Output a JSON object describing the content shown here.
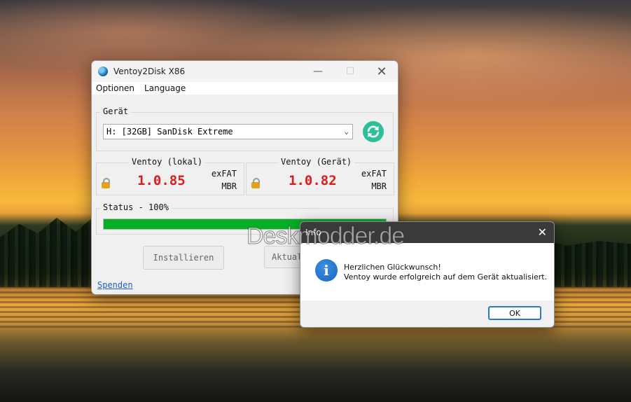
{
  "watermark": "Deskmodder.de",
  "window": {
    "title": "Ventoy2Disk  X86",
    "menu": [
      "Optionen",
      "Language"
    ],
    "device_group_label": "Gerät",
    "device_selected": "H: [32GB] SanDisk Extreme",
    "local": {
      "label": "Ventoy (lokal)",
      "version": "1.0.85",
      "fs": "exFAT",
      "partition": "MBR"
    },
    "device": {
      "label": "Ventoy (Gerät)",
      "version": "1.0.82",
      "fs": "exFAT",
      "partition": "MBR"
    },
    "status_label": "Status - 100%",
    "progress_percent": 100,
    "install_button": "Installieren",
    "update_button": "Aktual",
    "donate_link": "Spenden"
  },
  "dialog": {
    "title": "Info",
    "line1": "Herzlichen Glückwunsch!",
    "line2": "Ventoy wurde erfolgreich auf dem Gerät aktualisiert.",
    "ok_label": "OK"
  },
  "colors": {
    "version_red": "#e11a1a",
    "progress_green": "#06b025",
    "refresh_teal": "#2bbf9a",
    "info_blue": "#1565c0"
  }
}
